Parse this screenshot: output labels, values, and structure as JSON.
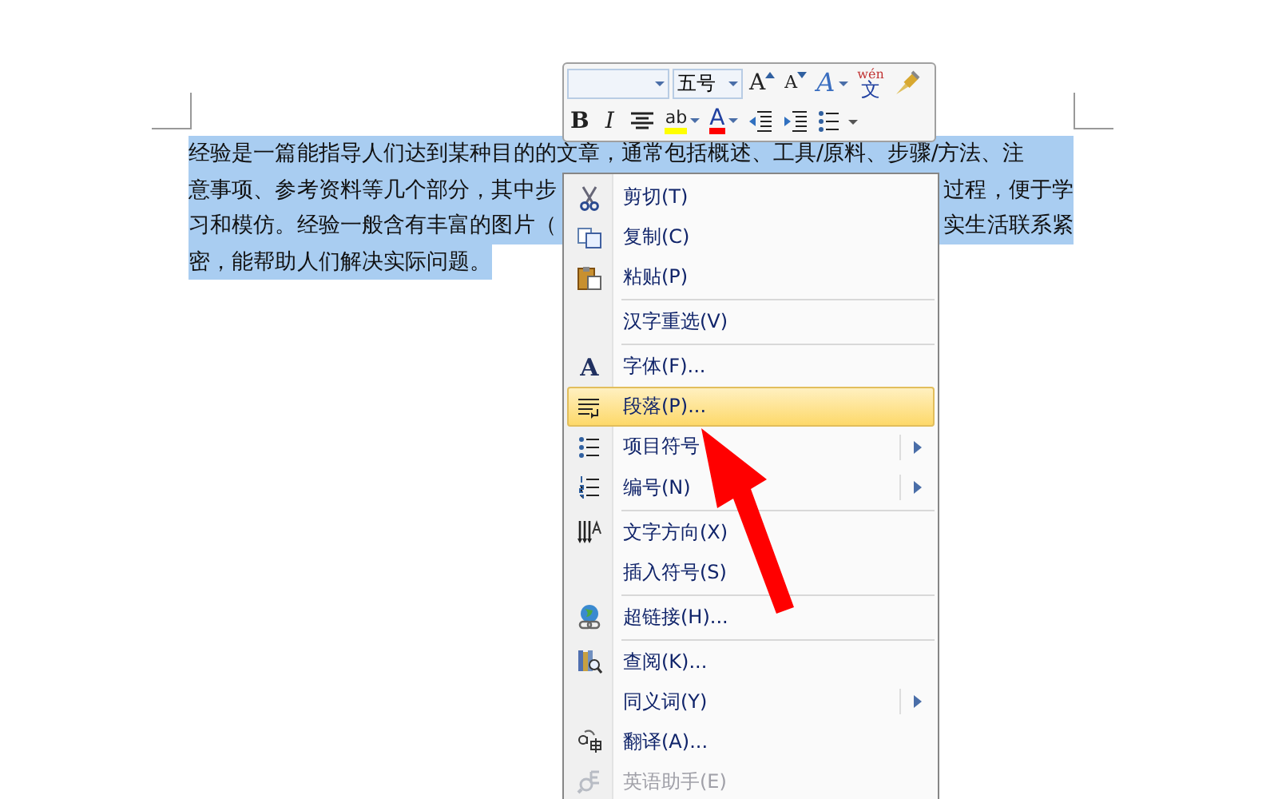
{
  "document": {
    "lines": [
      {
        "left": "经验是一篇能指导人们达到某种目的的文章，通常包括概述、工具/原料、步骤/方法、注",
        "selected": true
      },
      {
        "left": "意事项、参考资料等几个部分，其中步",
        "right": "过程，便于学",
        "selected": true
      },
      {
        "left": "习和模仿。经验一般含有丰富的图片（",
        "right": "实生活联系紧",
        "selected": true
      },
      {
        "left": "密，能帮助人们解决实际问题。",
        "selected": true
      }
    ]
  },
  "mini_toolbar": {
    "font_size": "五号",
    "row1": [
      {
        "kind": "grow",
        "glyph": "A"
      },
      {
        "kind": "shrink",
        "glyph": "A"
      },
      {
        "kind": "style",
        "glyph": "A"
      },
      {
        "kind": "phonetic",
        "glyph": "文",
        "ruby": "wén"
      },
      {
        "kind": "painter"
      }
    ],
    "row2": [
      {
        "kind": "bold",
        "glyph": "B"
      },
      {
        "kind": "italic",
        "glyph": "I"
      },
      {
        "kind": "center"
      },
      {
        "kind": "highlight",
        "glyph": "ab",
        "color": "#ffff00"
      },
      {
        "kind": "fontcolor",
        "glyph": "A",
        "color": "#ff0000"
      },
      {
        "kind": "outdent"
      },
      {
        "kind": "indent"
      },
      {
        "kind": "bullets"
      }
    ]
  },
  "context_menu": {
    "groups": [
      [
        {
          "label": "剪切(T)",
          "selected": false,
          "disabled": false,
          "submenu": false
        },
        {
          "label": "复制(C)",
          "selected": false,
          "disabled": false,
          "submenu": false
        },
        {
          "label": "粘贴(P)",
          "selected": false,
          "disabled": false,
          "submenu": false
        }
      ],
      [
        {
          "label": "汉字重选(V)",
          "selected": false,
          "disabled": false,
          "submenu": false
        }
      ],
      [
        {
          "label": "字体(F)...",
          "selected": false,
          "disabled": false,
          "submenu": false,
          "icon_glyph": "A"
        },
        {
          "label": "段落(P)...",
          "selected": true,
          "disabled": false,
          "submenu": false
        },
        {
          "label": "项目符号",
          "selected": false,
          "disabled": false,
          "submenu": true
        },
        {
          "label": "编号(N)",
          "selected": false,
          "disabled": false,
          "submenu": true
        }
      ],
      [
        {
          "label": "文字方向(X)",
          "selected": false,
          "disabled": false,
          "submenu": false
        },
        {
          "label": "插入符号(S)",
          "selected": false,
          "disabled": false,
          "submenu": false
        }
      ],
      [
        {
          "label": "超链接(H)...",
          "selected": false,
          "disabled": false,
          "submenu": false
        }
      ],
      [
        {
          "label": "查阅(K)...",
          "selected": false,
          "disabled": false,
          "submenu": false
        },
        {
          "label": "同义词(Y)",
          "selected": false,
          "disabled": false,
          "submenu": true
        },
        {
          "label": "翻译(A)...",
          "selected": false,
          "disabled": false,
          "submenu": false
        },
        {
          "label": "英语助手(E)",
          "selected": false,
          "disabled": true,
          "submenu": false
        }
      ]
    ]
  }
}
